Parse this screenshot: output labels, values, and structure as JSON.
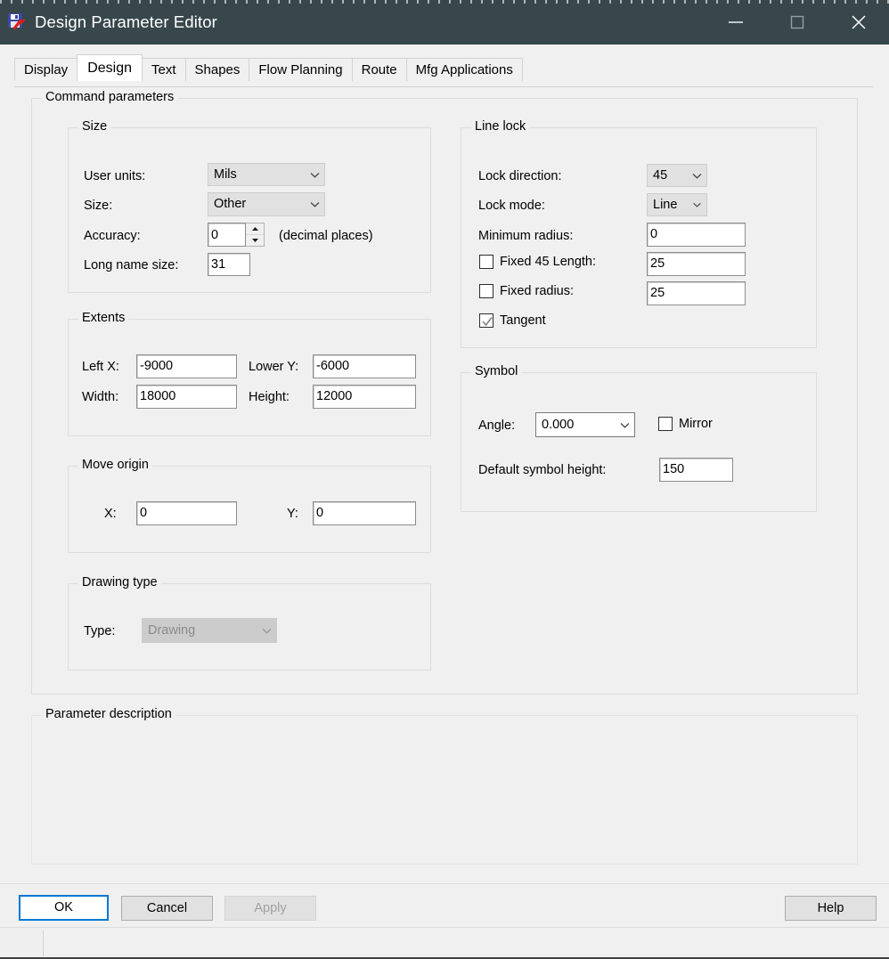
{
  "window": {
    "title": "Design Parameter Editor",
    "icon": "floppy-disk-icon",
    "minimize_label": "Minimize",
    "maximize_label": "Maximize",
    "close_label": "Close",
    "titlebar_color": "#37474b"
  },
  "tabs": [
    {
      "label": "Display",
      "active": false
    },
    {
      "label": "Design",
      "active": true
    },
    {
      "label": "Text",
      "active": false
    },
    {
      "label": "Shapes",
      "active": false
    },
    {
      "label": "Flow Planning",
      "active": false
    },
    {
      "label": "Route",
      "active": false
    },
    {
      "label": "Mfg Applications",
      "active": false
    }
  ],
  "command_parameters": {
    "legend": "Command parameters",
    "size": {
      "legend": "Size",
      "user_units_label": "User units:",
      "user_units_value": "Mils",
      "size_label": "Size:",
      "size_value": "Other",
      "accuracy_label": "Accuracy:",
      "accuracy_value": "0",
      "accuracy_suffix": "(decimal places)",
      "long_name_size_label": "Long name size:",
      "long_name_size_value": "31"
    },
    "extents": {
      "legend": "Extents",
      "left_x_label": "Left X:",
      "left_x_value": "-9000",
      "lower_y_label": "Lower Y:",
      "lower_y_value": "-6000",
      "width_label": "Width:",
      "width_value": "18000",
      "height_label": "Height:",
      "height_value": "12000"
    },
    "move_origin": {
      "legend": "Move origin",
      "x_label": "X:",
      "x_value": "0",
      "y_label": "Y:",
      "y_value": "0"
    },
    "drawing_type": {
      "legend": "Drawing type",
      "type_label": "Type:",
      "type_value": "Drawing"
    },
    "line_lock": {
      "legend": "Line lock",
      "lock_direction_label": "Lock direction:",
      "lock_direction_value": "45",
      "lock_mode_label": "Lock mode:",
      "lock_mode_value": "Line",
      "minimum_radius_label": "Minimum radius:",
      "minimum_radius_value": "0",
      "fixed_45_length_label": "Fixed 45 Length:",
      "fixed_45_length_checked": false,
      "fixed_45_length_value": "25",
      "fixed_radius_label": "Fixed radius:",
      "fixed_radius_checked": false,
      "fixed_radius_value": "25",
      "tangent_label": "Tangent",
      "tangent_checked": true
    },
    "symbol": {
      "legend": "Symbol",
      "angle_label": "Angle:",
      "angle_value": "0.000",
      "mirror_label": "Mirror",
      "mirror_checked": false,
      "default_symbol_height_label": "Default symbol height:",
      "default_symbol_height_value": "150"
    }
  },
  "parameter_description": {
    "legend": "Parameter description",
    "text": ""
  },
  "footer": {
    "ok_label": "OK",
    "cancel_label": "Cancel",
    "apply_label": "Apply",
    "help_label": "Help",
    "apply_disabled": true,
    "default_button_accent": "#0078d7"
  },
  "statusbar": {
    "text": ""
  }
}
